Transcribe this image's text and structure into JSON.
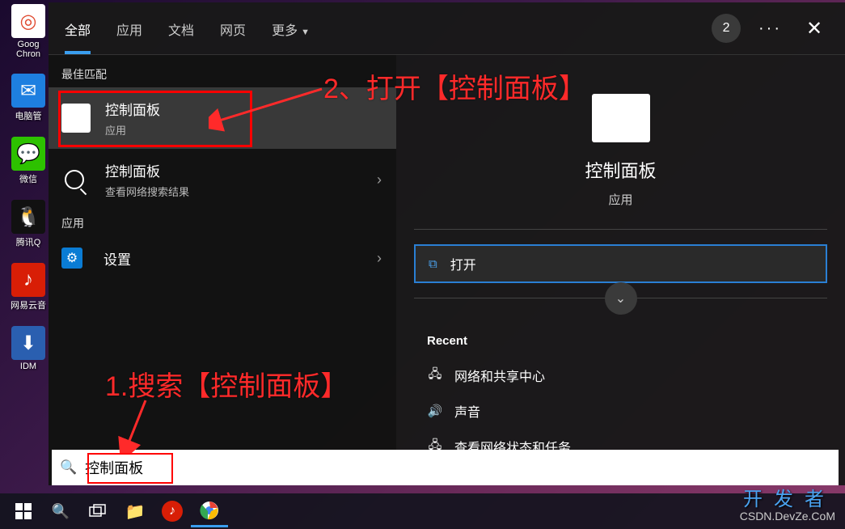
{
  "desktop": {
    "icons": [
      {
        "label": "Goog",
        "sub": "Chron",
        "bg": "#fff",
        "glyph": "◎"
      },
      {
        "label": "电脑管",
        "bg": "#1e7fe0",
        "glyph": "✉"
      },
      {
        "label": "微信",
        "bg": "#2dc100",
        "glyph": "💬"
      },
      {
        "label": "腾讯Q",
        "bg": "#111",
        "glyph": "🐧"
      },
      {
        "label": "网易云音",
        "bg": "#d81e06",
        "glyph": "♪"
      },
      {
        "label": "IDM",
        "bg": "#2a5fb0",
        "glyph": "⬇"
      }
    ]
  },
  "search_panel": {
    "tabs": [
      "全部",
      "应用",
      "文档",
      "网页"
    ],
    "more_label": "更多",
    "badge": "2",
    "sections": {
      "best_match": "最佳匹配",
      "apps": "应用"
    },
    "results": [
      {
        "title": "控制面板",
        "sub": "应用",
        "icon": "control-panel",
        "selected": true
      },
      {
        "title": "控制面板",
        "sub": "查看网络搜索结果",
        "icon": "search",
        "chevron": true
      }
    ],
    "app_results": [
      {
        "title": "设置",
        "icon": "settings",
        "chevron": true
      }
    ],
    "preview": {
      "title": "控制面板",
      "sub": "应用",
      "open_label": "打开",
      "recent_label": "Recent",
      "recent": [
        {
          "label": "网络和共享中心",
          "icon": "network"
        },
        {
          "label": "声音",
          "icon": "sound"
        },
        {
          "label": "查看网络状态和任务",
          "icon": "network"
        }
      ]
    }
  },
  "search_input": {
    "value": "控制面板"
  },
  "annotations": {
    "step1": "1.搜索【控制面板】",
    "step2": "2、打开【控制面板】"
  },
  "watermark": {
    "line1": "开发者",
    "line2": "CSDN.DevZe.CoM"
  }
}
